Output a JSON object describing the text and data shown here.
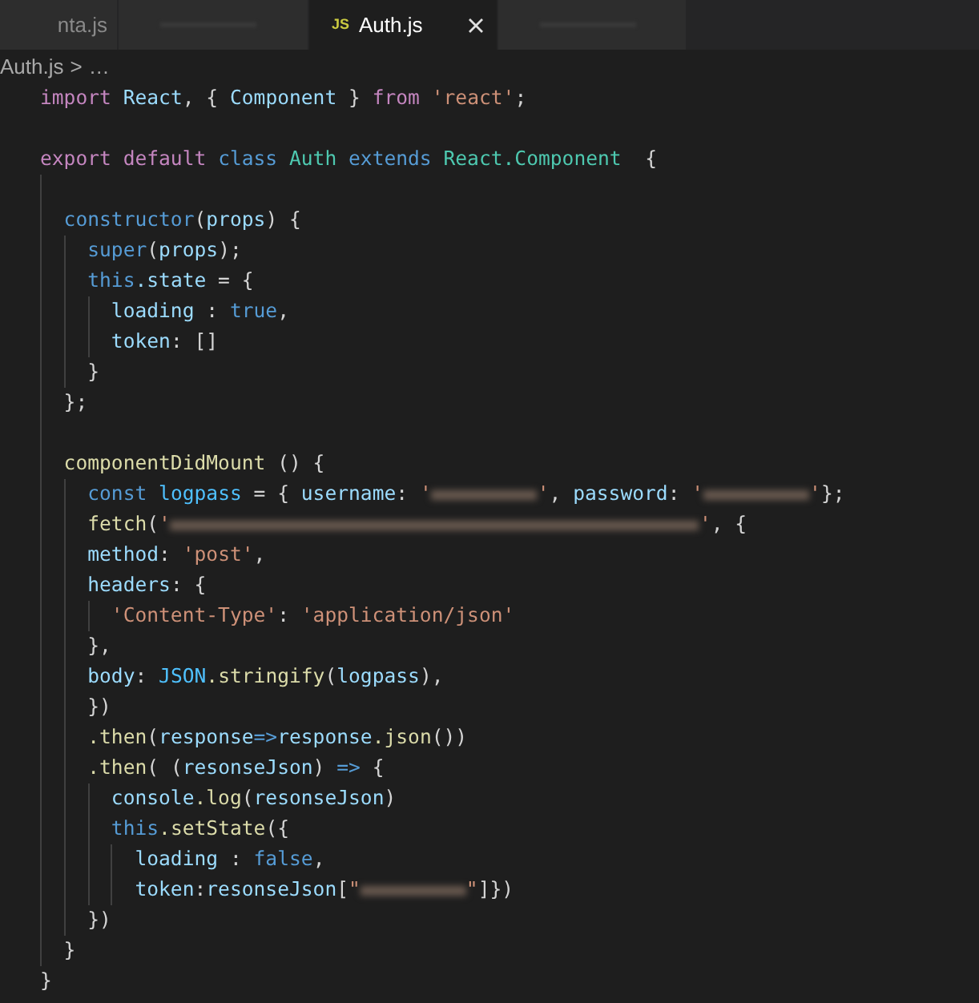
{
  "tabs": [
    {
      "label": "nta.js",
      "selected": false
    },
    {
      "selected": false
    },
    {
      "label": "Auth.js",
      "badge": "JS",
      "selected": true
    },
    {
      "selected": false
    }
  ],
  "breadcrumb": {
    "file": "Auth.js",
    "separator": ">",
    "rest": "…"
  },
  "code_blocks": [
    {
      "lines": [
        {
          "tokens": [
            {
              "text": "import ",
              "kind": "ctrl"
            },
            {
              "text": "React",
              "kind": "var"
            },
            {
              "text": ", { "
            },
            {
              "text": "Component",
              "kind": "var"
            },
            {
              "text": " } "
            },
            {
              "text": "from ",
              "kind": "ctrl"
            },
            {
              "text": "'react'",
              "kind": "str"
            },
            {
              "text": ";"
            }
          ]
        }
      ]
    },
    {
      "lines": [
        {
          "tokens": [
            {
              "text": "export default ",
              "kind": "ctrl"
            },
            {
              "text": "class ",
              "kind": "kw"
            },
            {
              "text": "Auth ",
              "kind": "cls"
            },
            {
              "text": "extends ",
              "kind": "kw"
            },
            {
              "text": "React",
              "kind": "cls"
            },
            {
              "text": ".Component",
              "kind": "cls"
            },
            {
              "text": "  {"
            }
          ]
        }
      ]
    },
    {
      "lines": [
        {
          "tokens": [
            {
              "text": "  constructor",
              "kind": "kw"
            },
            {
              "text": "("
            },
            {
              "text": "props",
              "kind": "var"
            },
            {
              "text": ") {"
            }
          ]
        },
        {
          "tokens": [
            {
              "text": "    super",
              "kind": "kw"
            },
            {
              "text": "("
            },
            {
              "text": "props",
              "kind": "var"
            },
            {
              "text": ");"
            }
          ]
        },
        {
          "tokens": [
            {
              "text": "    this",
              "kind": "kw"
            },
            {
              "text": ".state",
              "kind": "var"
            },
            {
              "text": " = {"
            }
          ]
        },
        {
          "tokens": [
            {
              "text": "      loading",
              "kind": "var"
            },
            {
              "text": " : "
            },
            {
              "text": "true",
              "kind": "kw"
            },
            {
              "text": ","
            }
          ]
        },
        {
          "tokens": [
            {
              "text": "      token",
              "kind": "var"
            },
            {
              "text": ": []"
            }
          ]
        },
        {
          "tokens": [
            {
              "text": "    }"
            }
          ]
        },
        {
          "tokens": [
            {
              "text": "  };"
            }
          ]
        }
      ]
    },
    {
      "lines": [
        {
          "tokens": [
            {
              "text": "  componentDidMount",
              "kind": "fn"
            },
            {
              "text": " () {"
            }
          ]
        },
        {
          "tokens": [
            {
              "text": "    const ",
              "kind": "kw"
            },
            {
              "text": "logpass",
              "kind": "cst"
            },
            {
              "text": " = { "
            },
            {
              "text": "username",
              "kind": "var"
            },
            {
              "text": ": "
            },
            {
              "text": "'",
              "kind": "str"
            },
            {
              "kind": "blur-short"
            },
            {
              "text": "'",
              "kind": "str"
            },
            {
              "text": ", "
            },
            {
              "text": "password",
              "kind": "var"
            },
            {
              "text": ": "
            },
            {
              "text": "'",
              "kind": "str"
            },
            {
              "kind": "blur-short"
            },
            {
              "text": "'",
              "kind": "str"
            },
            {
              "text": "};"
            }
          ]
        },
        {
          "tokens": [
            {
              "text": "    fetch",
              "kind": "fn"
            },
            {
              "text": "("
            },
            {
              "text": "'",
              "kind": "str"
            },
            {
              "kind": "blur-long"
            },
            {
              "text": "'",
              "kind": "str"
            },
            {
              "text": ", {"
            }
          ]
        },
        {
          "tokens": [
            {
              "text": "    method",
              "kind": "var"
            },
            {
              "text": ": "
            },
            {
              "text": "'post'",
              "kind": "str"
            },
            {
              "text": ","
            }
          ]
        },
        {
          "tokens": [
            {
              "text": "    headers",
              "kind": "var"
            },
            {
              "text": ": {"
            }
          ]
        },
        {
          "tokens": [
            {
              "text": "      'Content-Type'",
              "kind": "str"
            },
            {
              "text": ": "
            },
            {
              "text": "'application/json'",
              "kind": "str"
            }
          ]
        },
        {
          "tokens": [
            {
              "text": "    },"
            }
          ]
        },
        {
          "tokens": [
            {
              "text": "    body",
              "kind": "var"
            },
            {
              "text": ": "
            },
            {
              "text": "JSON",
              "kind": "cst"
            },
            {
              "text": ".stringify",
              "kind": "fn"
            },
            {
              "text": "("
            },
            {
              "text": "logpass",
              "kind": "var"
            },
            {
              "text": "),"
            }
          ]
        },
        {
          "tokens": [
            {
              "text": "    })"
            }
          ]
        },
        {
          "tokens": [
            {
              "text": "    .then",
              "kind": "fn"
            },
            {
              "text": "("
            },
            {
              "text": "response",
              "kind": "var"
            },
            {
              "text": "=>",
              "kind": "kw"
            },
            {
              "text": "response",
              "kind": "var"
            },
            {
              "text": ".json",
              "kind": "fn"
            },
            {
              "text": "())"
            }
          ]
        },
        {
          "tokens": [
            {
              "text": "    .then",
              "kind": "fn"
            },
            {
              "text": "( ("
            },
            {
              "text": "resonseJson",
              "kind": "var"
            },
            {
              "text": ") "
            },
            {
              "text": "=>",
              "kind": "kw"
            },
            {
              "text": " {"
            }
          ]
        },
        {
          "tokens": [
            {
              "text": "      console",
              "kind": "var"
            },
            {
              "text": ".log",
              "kind": "fn"
            },
            {
              "text": "("
            },
            {
              "text": "resonseJson",
              "kind": "var"
            },
            {
              "text": ")"
            }
          ]
        },
        {
          "tokens": [
            {
              "text": "      this",
              "kind": "kw"
            },
            {
              "text": ".setState",
              "kind": "fn"
            },
            {
              "text": "({"
            }
          ]
        },
        {
          "tokens": [
            {
              "text": "        loading",
              "kind": "var"
            },
            {
              "text": " : "
            },
            {
              "text": "false",
              "kind": "kw"
            },
            {
              "text": ","
            }
          ]
        },
        {
          "tokens": [
            {
              "text": "        token",
              "kind": "var"
            },
            {
              "text": ":"
            },
            {
              "text": "resonseJson",
              "kind": "var"
            },
            {
              "text": "["
            },
            {
              "text": "\"",
              "kind": "str"
            },
            {
              "kind": "blur-short"
            },
            {
              "text": "\"",
              "kind": "str"
            },
            {
              "text": "]})"
            }
          ]
        },
        {
          "tokens": [
            {
              "text": "    })"
            }
          ]
        },
        {
          "tokens": [
            {
              "text": "  }"
            }
          ]
        },
        {
          "tokens": [
            {
              "text": "}"
            }
          ]
        }
      ]
    }
  ]
}
